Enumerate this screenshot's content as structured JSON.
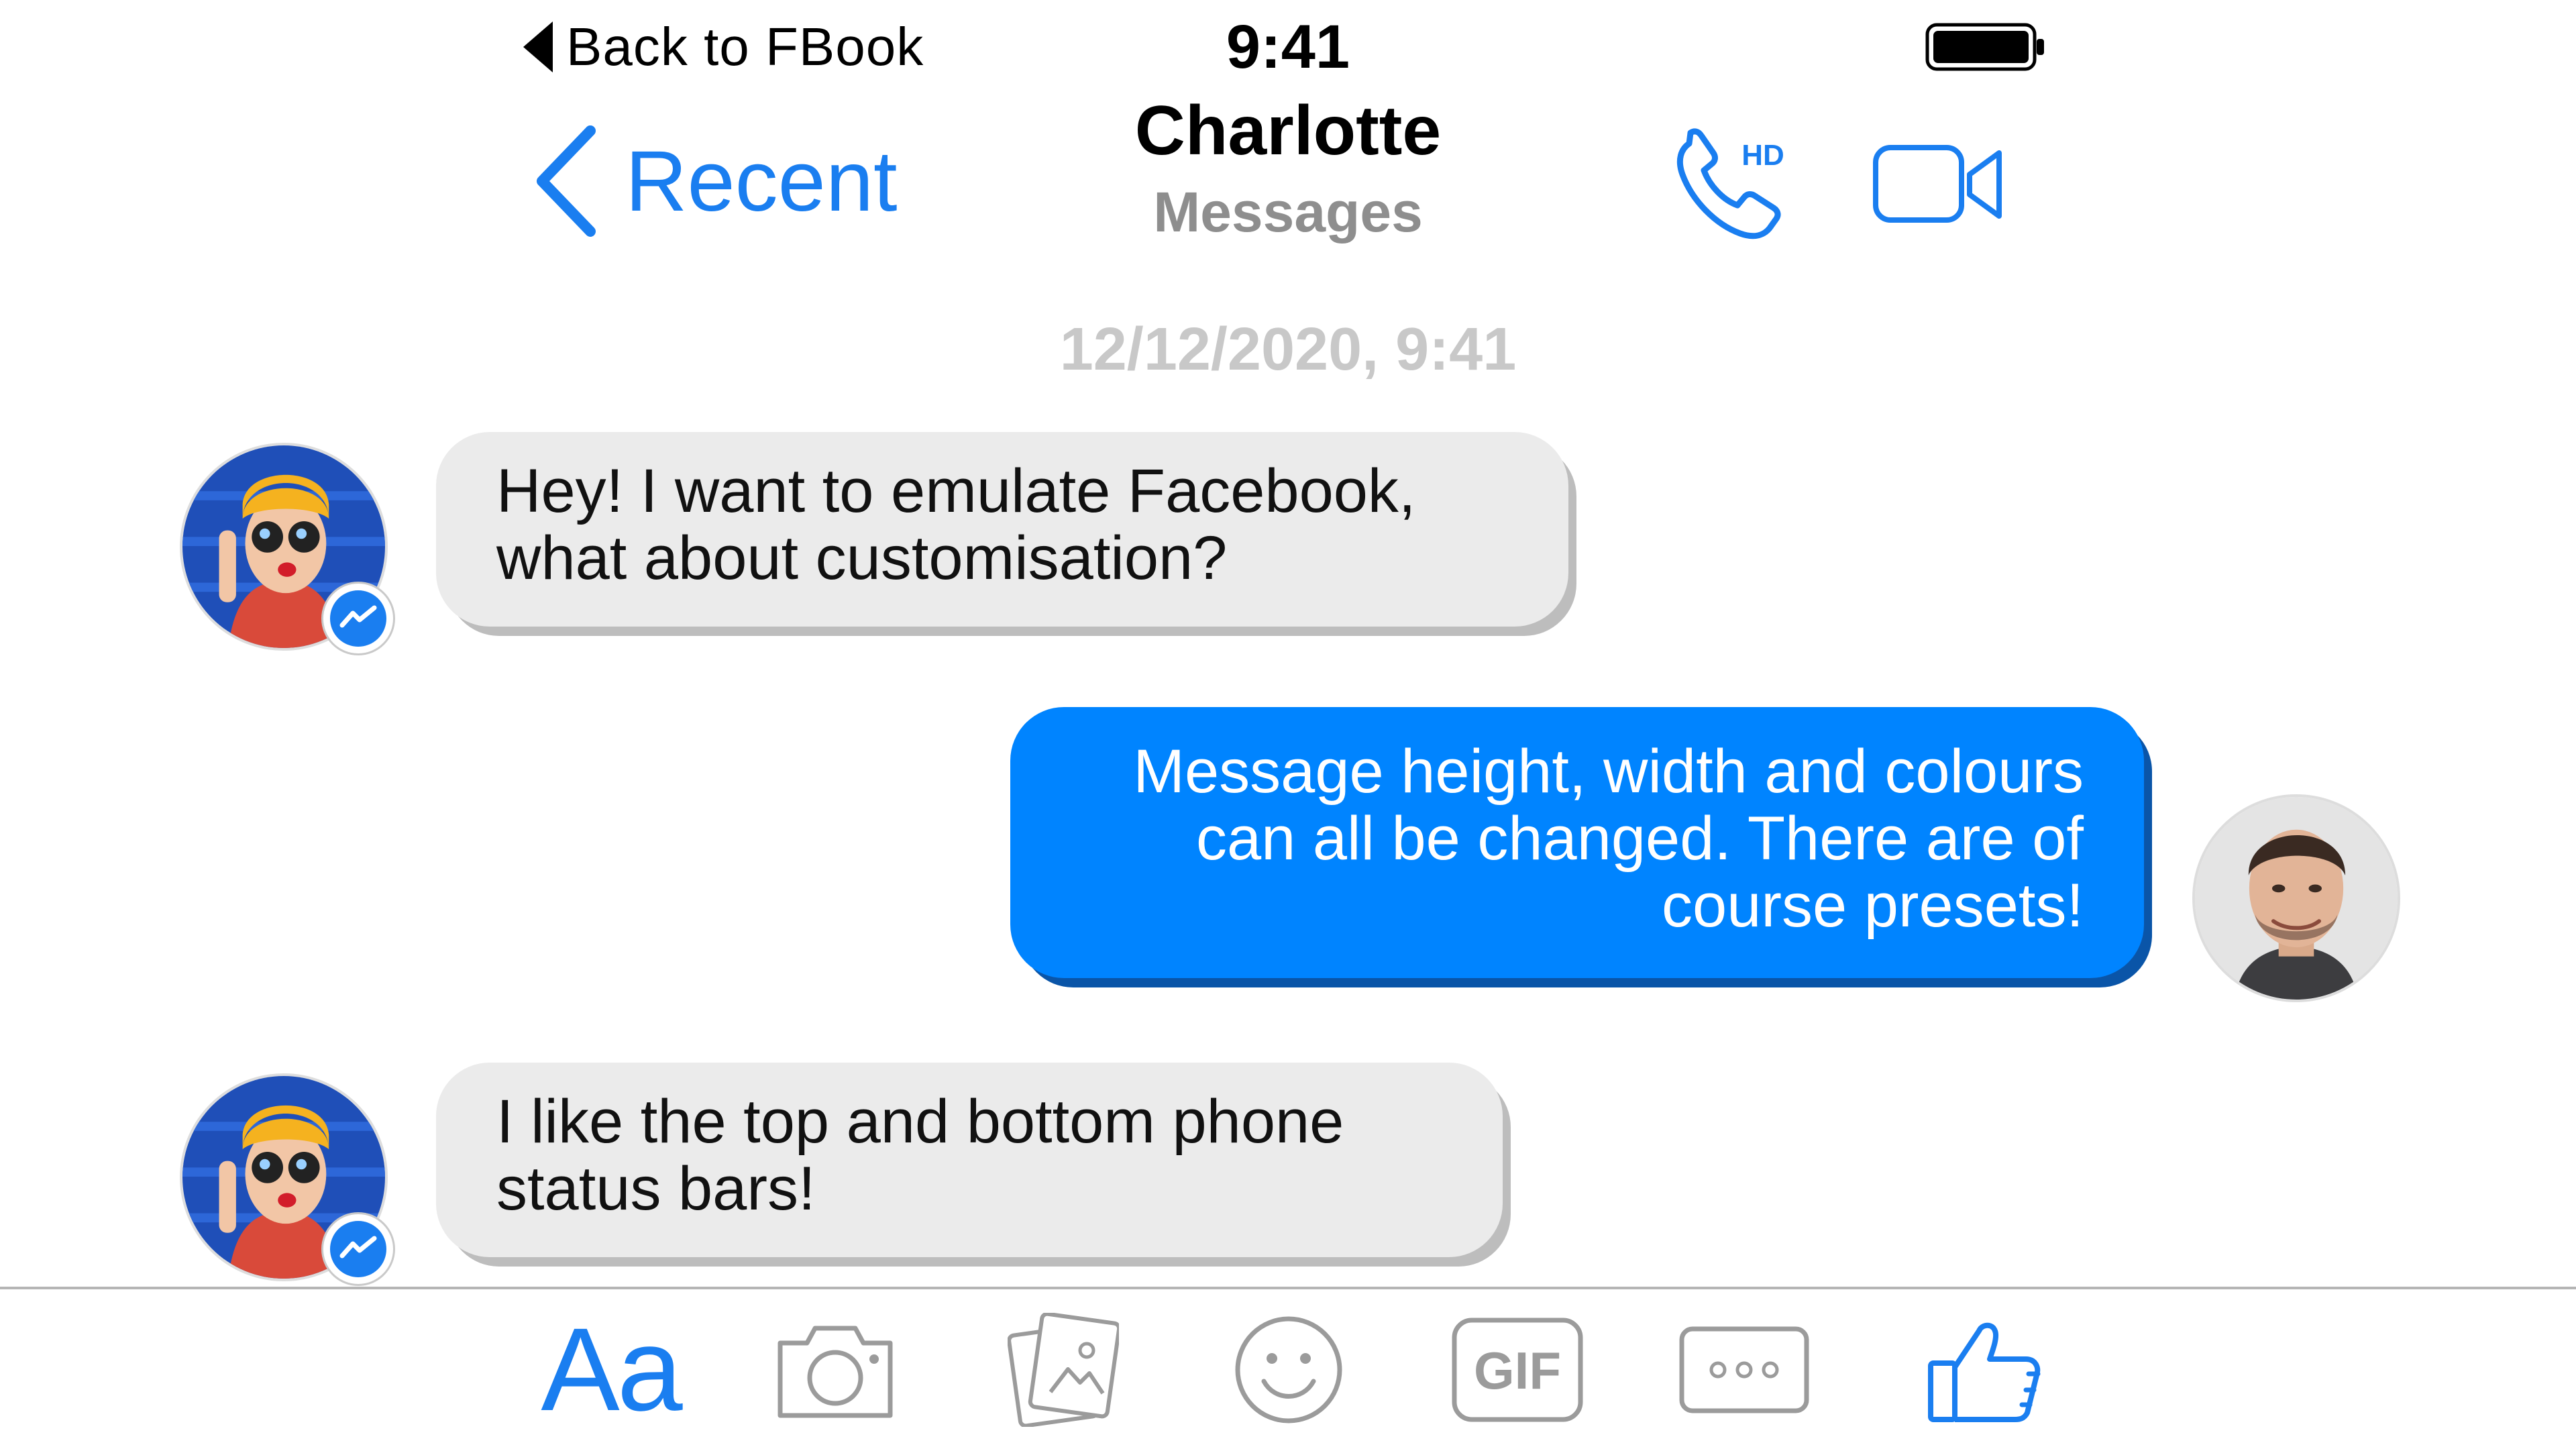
{
  "status_bar": {
    "back_label": "Back to FBook",
    "time": "9:41"
  },
  "nav": {
    "back_label": "Recent",
    "title": "Charlotte",
    "subtitle": "Messages",
    "call_badge": "HD"
  },
  "conversation": {
    "timestamp": "12/12/2020, 9:41",
    "messages": [
      {
        "sender": "contact",
        "line1": "Hey! I want to emulate Facebook,",
        "line2": "what about customisation?"
      },
      {
        "sender": "me",
        "line1": "Message height, width and colours",
        "line2": "can all be changed. There are of",
        "line3": "course presets!"
      },
      {
        "sender": "contact",
        "line1": "I like the top and bottom phone",
        "line2": "status bars!"
      }
    ]
  },
  "toolbar": {
    "text_label": "Aa",
    "gif_label": "GIF",
    "icons": [
      "camera-icon",
      "photo-gallery-icon",
      "emoji-icon",
      "gif-icon",
      "more-icon",
      "thumbs-up-icon"
    ]
  },
  "colors": {
    "accent": "#1a7ef0",
    "outgoing_bubble": "#0084ff",
    "incoming_bubble": "#ebebeb",
    "timestamp": "#c8c8c8",
    "icon_gray": "#9b9b9b"
  }
}
